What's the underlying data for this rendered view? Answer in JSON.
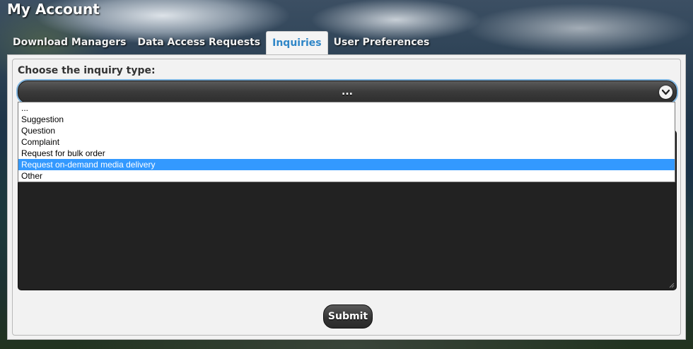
{
  "header": {
    "title": "My Account"
  },
  "tabs": [
    {
      "label": "Download Managers",
      "active": false
    },
    {
      "label": "Data Access Requests",
      "active": false
    },
    {
      "label": "Inquiries",
      "active": true
    },
    {
      "label": "User Preferences",
      "active": false
    }
  ],
  "form": {
    "type_label": "Choose the inquiry type:",
    "type_value": "...",
    "submit_label": "Submit"
  },
  "dropdown": {
    "options": [
      "...",
      "Suggestion",
      "Question",
      "Complaint",
      "Request for bulk order",
      "Request on-demand media delivery",
      "Other"
    ],
    "highlighted": "Request on-demand media delivery"
  },
  "colors": {
    "active_tab_text": "#2f86c7",
    "highlight": "#3399ff",
    "control_dark": "#333333"
  }
}
